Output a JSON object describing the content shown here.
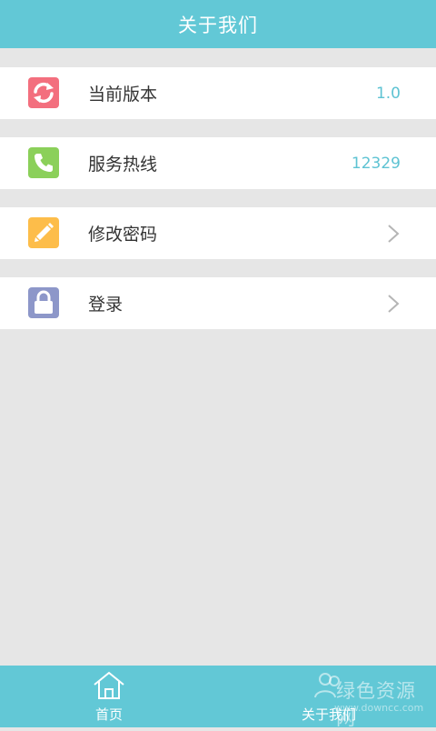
{
  "header": {
    "title": "关于我们"
  },
  "rows": [
    {
      "label": "当前版本",
      "value": "1.0",
      "icon": "refresh-icon",
      "icon_color": "#f36f7e"
    },
    {
      "label": "服务热线",
      "value": "12329",
      "icon": "phone-icon",
      "icon_color": "#8bd05a"
    },
    {
      "label": "修改密码",
      "icon": "pencil-icon",
      "icon_color": "#fdbd4a",
      "has_chevron": true
    },
    {
      "label": "登录",
      "icon": "lock-icon",
      "icon_color": "#8d97c9",
      "has_chevron": true
    }
  ],
  "tabbar": {
    "tabs": [
      {
        "label": "首页",
        "icon": "home-icon"
      },
      {
        "label": "关于我们",
        "icon": "people-icon"
      }
    ]
  },
  "watermark": {
    "text": "绿色资源网",
    "url": "www.downcc.com"
  },
  "colors": {
    "accent": "#62c8d6",
    "value_text": "#5ec3d3",
    "background": "#e6e6e6"
  }
}
